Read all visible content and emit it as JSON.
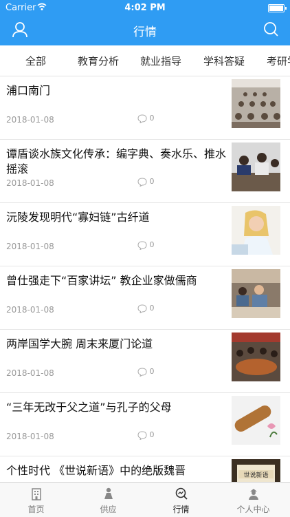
{
  "status": {
    "carrier": "Carrier",
    "time": "4:02 PM"
  },
  "nav": {
    "title": "行情",
    "left_icon": "user-icon",
    "right_icon": "search-icon"
  },
  "tabs": [
    "全部",
    "教育分析",
    "就业指导",
    "学科答疑",
    "考研学"
  ],
  "items": [
    {
      "title": "浦口南门",
      "date": "2018-01-08",
      "comments": "0"
    },
    {
      "title": "谭盾谈水族文化传承：编字典、奏水乐、推水摇滚",
      "date": "2018-01-08",
      "comments": "0"
    },
    {
      "title": "沅陵发现明代“寡妇链”古纤道",
      "date": "2018-01-08",
      "comments": "0"
    },
    {
      "title": "曾仕强走下“百家讲坛” 教企业家做儒商",
      "date": "2018-01-08",
      "comments": "0"
    },
    {
      "title": "两岸国学大腕 周末来厦门论道",
      "date": "2018-01-08",
      "comments": "0"
    },
    {
      "title": "“三年无改于父之道”与孔子的父母",
      "date": "2018-01-08",
      "comments": "0"
    },
    {
      "title": "个性时代 《世说新语》中的绝版魏晋",
      "date": "",
      "comments": ""
    }
  ],
  "thumb_caption": "世说新语",
  "tabbar": [
    {
      "label": "首页",
      "icon": "building-icon"
    },
    {
      "label": "供应",
      "icon": "person-icon"
    },
    {
      "label": "行情",
      "icon": "chart-magnifier-icon"
    },
    {
      "label": "个人中心",
      "icon": "profile-icon"
    }
  ],
  "colors": {
    "accent": "#2f9cf3"
  }
}
